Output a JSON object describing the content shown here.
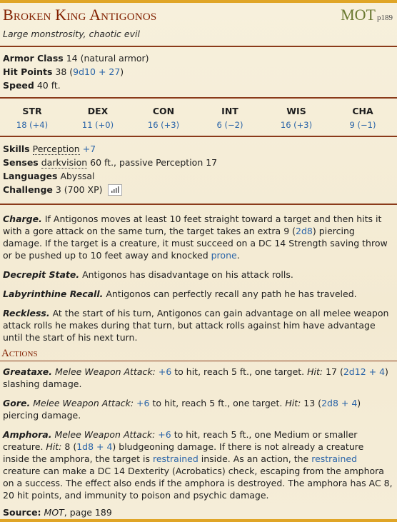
{
  "header": {
    "name": "Broken King Antigonos",
    "source_abbr": "MOT",
    "source_page": "p189",
    "subtitle": "Large monstrosity, chaotic evil"
  },
  "stats": {
    "ac_label": "Armor Class",
    "ac_value": "14 (natural armor)",
    "hp_label": "Hit Points",
    "hp_value": "38",
    "hp_formula": "9d10 + 27",
    "speed_label": "Speed",
    "speed_value": "40 ft."
  },
  "abilities": [
    {
      "name": "STR",
      "value": "18 (+4)"
    },
    {
      "name": "DEX",
      "value": "11 (+0)"
    },
    {
      "name": "CON",
      "value": "16 (+3)"
    },
    {
      "name": "INT",
      "value": "6 (−2)"
    },
    {
      "name": "WIS",
      "value": "16 (+3)"
    },
    {
      "name": "CHA",
      "value": "9 (−1)"
    }
  ],
  "details": {
    "skills_label": "Skills",
    "skills_name": "Perception",
    "skills_bonus": "+7",
    "senses_label": "Senses",
    "senses_link": "darkvision",
    "senses_rest": " 60 ft., passive Perception 17",
    "languages_label": "Languages",
    "languages_value": "Abyssal",
    "challenge_label": "Challenge",
    "challenge_value": "3 (700 XP)",
    "challenge_icon": "bar-chart-icon"
  },
  "traits": {
    "charge_name": "Charge.",
    "charge_t1": " If Antigonos moves at least 10 feet straight toward a target and then hits it with a gore attack on the same turn, the target takes an extra 9 (",
    "charge_dice": "2d8",
    "charge_t2": ") piercing damage. If the target is a creature, it must succeed on a DC 14 Strength saving throw or be pushed up to 10 feet away and knocked ",
    "charge_link": "prone",
    "charge_t3": ".",
    "decrepit_name": "Decrepit State.",
    "decrepit_text": " Antigonos has disadvantage on his attack rolls.",
    "labyrinth_name": "Labyrinthine Recall.",
    "labyrinth_text": " Antigonos can perfectly recall any path he has traveled.",
    "reckless_name": "Reckless.",
    "reckless_text": " At the start of his turn, Antigonos can gain advantage on all melee weapon attack rolls he makes during that turn, but attack rolls against him have advantage until the start of his next turn."
  },
  "actions": {
    "header": "Actions",
    "greataxe_name": "Greataxe.",
    "greataxe_type": " Melee Weapon Attack:",
    "greataxe_bonus": "+6",
    "greataxe_t1": " to hit, reach 5 ft., one target. ",
    "hit_label": "Hit:",
    "greataxe_t2": " 17 (",
    "greataxe_dice": "2d12 + 4",
    "greataxe_t3": ") slashing damage.",
    "gore_name": "Gore.",
    "gore_type": " Melee Weapon Attack:",
    "gore_bonus": "+6",
    "gore_t1": " to hit, reach 5 ft., one target. ",
    "gore_t2": " 13 (",
    "gore_dice": "2d8 + 4",
    "gore_t3": ") piercing damage.",
    "amphora_name": "Amphora.",
    "amphora_type": " Melee Weapon Attack:",
    "amphora_bonus": "+6",
    "amphora_t1": " to hit, reach 5 ft., one Medium or smaller creature. ",
    "amphora_t2": " 8 (",
    "amphora_dice": "1d8 + 4",
    "amphora_t3": ") bludgeoning damage. If there is not already a creature inside the amphora, the target is ",
    "amphora_link1": "restrained",
    "amphora_t4": " inside. As an action, the ",
    "amphora_link2": "restrained",
    "amphora_t5": " creature can make a DC 14 Dexterity (Acrobatics) check, escaping from the amphora on a success. The effect also ends if the amphora is destroyed. The amphora has AC 8, 20 hit points, and immunity to poison and psychic damage."
  },
  "footer": {
    "source_label": "Source:",
    "source_book": "MOT",
    "source_rest": ", page 189"
  },
  "colors": {
    "accent_gold": "#e0a526",
    "title_red": "#822000",
    "link_blue": "#2a64a8",
    "source_green": "#6b7a32"
  }
}
